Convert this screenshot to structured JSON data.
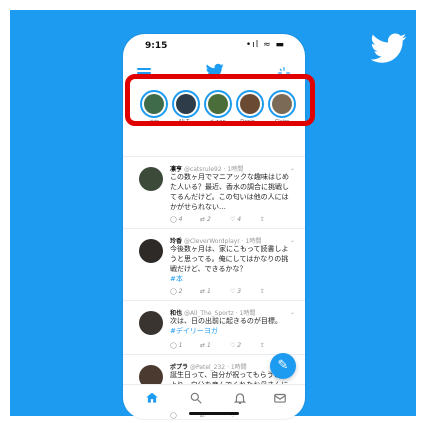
{
  "status": {
    "time": "9:15",
    "signal": "•ıl ≈ ▬"
  },
  "fleets": [
    {
      "name": "追加",
      "color": "#3f6b4a"
    },
    {
      "name": "Ali T...",
      "color": "#2e3b48"
    },
    {
      "name": "ri-wan",
      "color": "#4b6d3a"
    },
    {
      "name": "Danin...",
      "color": "#6a4a32"
    },
    {
      "name": "Claire",
      "color": "#7a6a56"
    }
  ],
  "tweets": [
    {
      "name": "凛亨",
      "handle": "@catsrule92 · 1時間",
      "text": "この数ヶ月でマニアックな趣味はじめた人いる？最近、香水の調合に挑戦してるんだけど。この匂いは他の人にはかがせられない…",
      "tag": "",
      "reply": "4",
      "retweet": "2",
      "like": "4",
      "avatar": "#3c4a3a"
    },
    {
      "name": "玲香",
      "handle": "@CleverWordplayr · 1時間",
      "text": "今後数ヶ月は、家にこもって読書しようと思ってる。俺にしてはかなりの挑戦だけど、できるかな？",
      "tag": "#本",
      "reply": "2",
      "retweet": "1",
      "like": "3",
      "avatar": "#2d2a28"
    },
    {
      "name": "和也",
      "handle": "@All_The_Sportz · 1時間",
      "text": "次は、日の出前に起きるのが目標。",
      "tag": "#デイリーヨガ",
      "reply": "1",
      "retweet": "1",
      "like": "2",
      "avatar": "#3a3430"
    },
    {
      "name": "ポプラ",
      "handle": "@Patel_232 · 1時間",
      "text": "誕生日って、自分が祝ってもらうことより、自分を産んでくれたお母さんに感謝することの方が大事な気がする。",
      "tag": "",
      "reply": "",
      "retweet": "",
      "like": "",
      "avatar": "#4a3a30"
    }
  ],
  "colors": {
    "accent": "#1d9bf0",
    "highlight": "#e00000"
  }
}
